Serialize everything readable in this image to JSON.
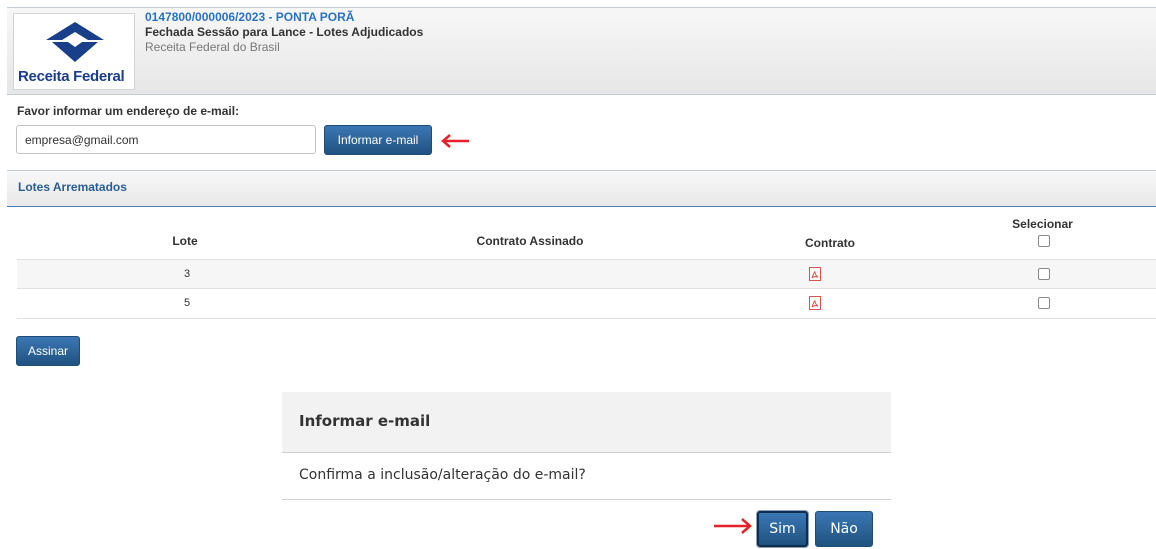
{
  "header": {
    "logo_text": "Receita Federal",
    "process_id": "0147800/000006/2023 - PONTA PORÃ",
    "status": "Fechada Sessão para Lance - Lotes Adjudicados",
    "organization": "Receita Federal do Brasil"
  },
  "email_form": {
    "label": "Favor informar um endereço de e-mail:",
    "value": "empresa@gmail.com",
    "button_label": "Informar e-mail"
  },
  "section": {
    "title": "Lotes Arrematados"
  },
  "table": {
    "columns": {
      "lote": "Lote",
      "contrato_assinado": "Contrato Assinado",
      "contrato": "Contrato",
      "selecionar": "Selecionar"
    },
    "rows": [
      {
        "lote": "3",
        "contrato_assinado": "",
        "contrato_icon": "pdf-icon",
        "selected": false
      },
      {
        "lote": "5",
        "contrato_assinado": "",
        "contrato_icon": "pdf-icon",
        "selected": false
      }
    ]
  },
  "actions": {
    "assinar_label": "Assinar"
  },
  "dialog": {
    "title": "Informar e-mail",
    "message": "Confirma a inclusão/alteração do e-mail?",
    "yes_label": "Sim",
    "no_label": "Não"
  },
  "colors": {
    "primary_button": "#2b5f93",
    "link_blue": "#2a72c4",
    "annotation_arrow": "#e8202a",
    "pdf_icon": "#d9534f"
  }
}
